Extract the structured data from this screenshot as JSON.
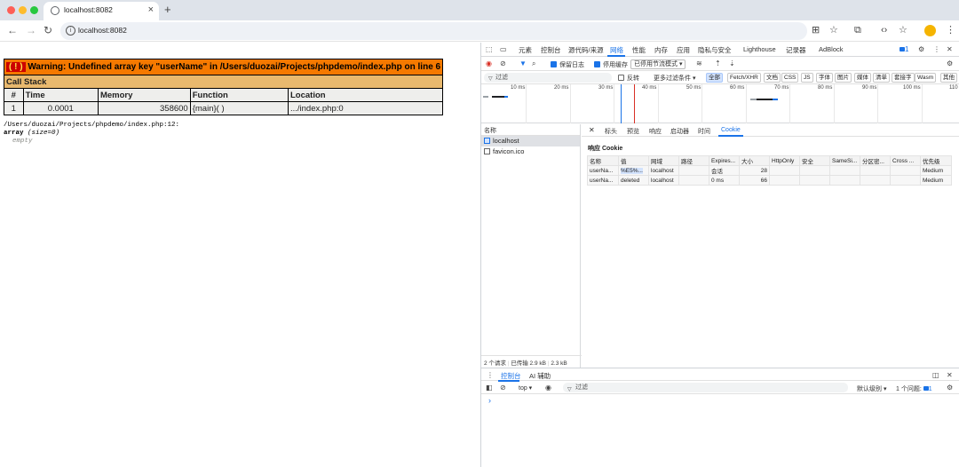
{
  "browser": {
    "tab_title": "localhost:8082",
    "tab_close": "×",
    "new_tab": "+",
    "url": "localhost:8082"
  },
  "page": {
    "warning_icon": "( ! )",
    "warning_text": "Warning: Undefined array key \"userName\" in /Users/duozai/Projects/phpdemo/index.php on line 6",
    "call_stack_label": "Call Stack",
    "columns": [
      "#",
      "Time",
      "Memory",
      "Function",
      "Location"
    ],
    "rows": [
      {
        "num": "1",
        "time": "0.0001",
        "memory": "358600",
        "function": "{main}( )",
        "location": ".../index.php:0"
      }
    ],
    "dump_path": "/Users/duozai/Projects/phpdemo/index.php:12:",
    "dump_type": "array",
    "dump_size": "(size=0)",
    "dump_empty": "empty"
  },
  "devtools": {
    "main_tabs": [
      "元素",
      "控制台",
      "源代码/来源",
      "网络",
      "性能",
      "内存",
      "应用",
      "隐私与安全",
      "Lighthouse",
      "记录器",
      "AdBlock"
    ],
    "active_main_tab": "网络",
    "issues_badge": "1",
    "preserve_log": "保留日志",
    "disable_cache": "停用缓存",
    "throttle": "已停用节流模式",
    "filter_placeholder": "过滤",
    "invert": "反转",
    "more_filters": "更多过滤条件",
    "type_filters": [
      "全部",
      "Fetch/XHR",
      "文档",
      "CSS",
      "JS",
      "字体",
      "图片",
      "媒体",
      "清单",
      "套接字",
      "Wasm",
      "其他"
    ],
    "timeline_ticks": [
      "10 ms",
      "20 ms",
      "30 ms",
      "40 ms",
      "50 ms",
      "60 ms",
      "70 ms",
      "80 ms",
      "90 ms",
      "100 ms",
      "110"
    ],
    "name_header": "名称",
    "requests": [
      "localhost",
      "favicon.ico"
    ],
    "detail_tabs": [
      "标头",
      "预览",
      "响应",
      "启动器",
      "时间",
      "Cookie"
    ],
    "active_detail_tab": "Cookie",
    "response_cookie_title": "响应 Cookie",
    "cookie_columns": [
      "名称",
      "值",
      "网域",
      "路径",
      "Expires...",
      "大小",
      "HttpOnly",
      "安全",
      "SameSi...",
      "分区密...",
      "Cross ...",
      "优先级"
    ],
    "cookie_rows": [
      [
        "userNa...",
        "%E5%...",
        "localhost",
        "",
        "会话",
        "28",
        "",
        "",
        "",
        "",
        "",
        "Medium"
      ],
      [
        "userNa...",
        "deleted",
        "localhost",
        "",
        "0 ms",
        "66",
        "",
        "",
        "",
        "",
        "",
        "Medium"
      ]
    ],
    "status": {
      "requests": "2 个请求",
      "transferred": "已传输 2.9 kB",
      "size": "2.3 kB"
    },
    "drawer_tabs": [
      "控制台",
      "AI 辅助"
    ],
    "console_context": "top",
    "console_filter_placeholder": "过滤",
    "log_level": "默认级别",
    "issues_count": "1 个问题:",
    "issues_count_badge": "1",
    "prompt_symbol": "›"
  },
  "colors": {
    "accent": "#1a73e8",
    "xdebug_warning": "#f57900",
    "xdebug_callstack": "#e9b96e",
    "xdebug_exclaim": "#cc0000"
  }
}
